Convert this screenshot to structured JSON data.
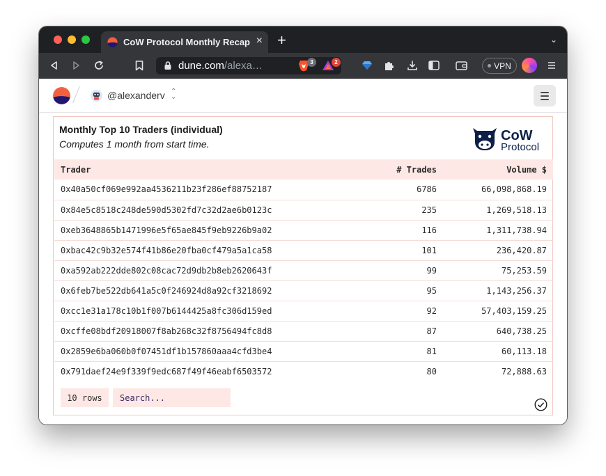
{
  "browser": {
    "tab_title": "CoW Protocol Monthly Recap",
    "new_tab_label": "+",
    "url_host": "dune.com",
    "url_rest": "/alexa…",
    "brave_badge": "3",
    "rewards_badge": "2",
    "vpn_label": "VPN"
  },
  "header": {
    "username": "@alexanderv"
  },
  "widget": {
    "title": "Monthly Top 10 Traders (individual)",
    "subtitle": "Computes 1 month from start time.",
    "logo_text_top": "CoW",
    "logo_text_bottom": "Protocol",
    "columns": [
      "Trader",
      "# Trades",
      "Volume $"
    ],
    "rows": [
      {
        "trader": "0x40a50cf069e992aa4536211b23f286ef88752187",
        "trades": "6786",
        "volume": "66,098,868.19"
      },
      {
        "trader": "0x84e5c8518c248de590d5302fd7c32d2ae6b0123c",
        "trades": "235",
        "volume": "1,269,518.13"
      },
      {
        "trader": "0xeb3648865b1471996e5f65ae845f9eb9226b9a02",
        "trades": "116",
        "volume": "1,311,738.94"
      },
      {
        "trader": "0xbac42c9b32e574f41b86e20fba0cf479a5a1ca58",
        "trades": "101",
        "volume": "236,420.87"
      },
      {
        "trader": "0xa592ab222dde802c08cac72d9db2b8eb2620643f",
        "trades": "99",
        "volume": "75,253.59"
      },
      {
        "trader": "0x6feb7be522db641a5c0f246924d8a92cf3218692",
        "trades": "95",
        "volume": "1,143,256.37"
      },
      {
        "trader": "0xcc1e31a178c10b1f007b6144425a8fc306d159ed",
        "trades": "92",
        "volume": "57,403,159.25"
      },
      {
        "trader": "0xcffe08bdf20918007f8ab268c32f8756494fc8d8",
        "trades": "87",
        "volume": "640,738.25"
      },
      {
        "trader": "0x2859e6ba060b0f07451df1b157860aaa4cfd3be4",
        "trades": "81",
        "volume": "60,113.18"
      },
      {
        "trader": "0x791daef24e9f339f9edc687f49f46eabf6503572",
        "trades": "80",
        "volume": "72,888.63"
      }
    ],
    "row_count_label": "10 rows",
    "search_placeholder": "Search..."
  },
  "colors": {
    "accent_pink": "#fde8e5",
    "border_pink": "#f2c7c0",
    "cow_navy": "#0d1f46"
  }
}
